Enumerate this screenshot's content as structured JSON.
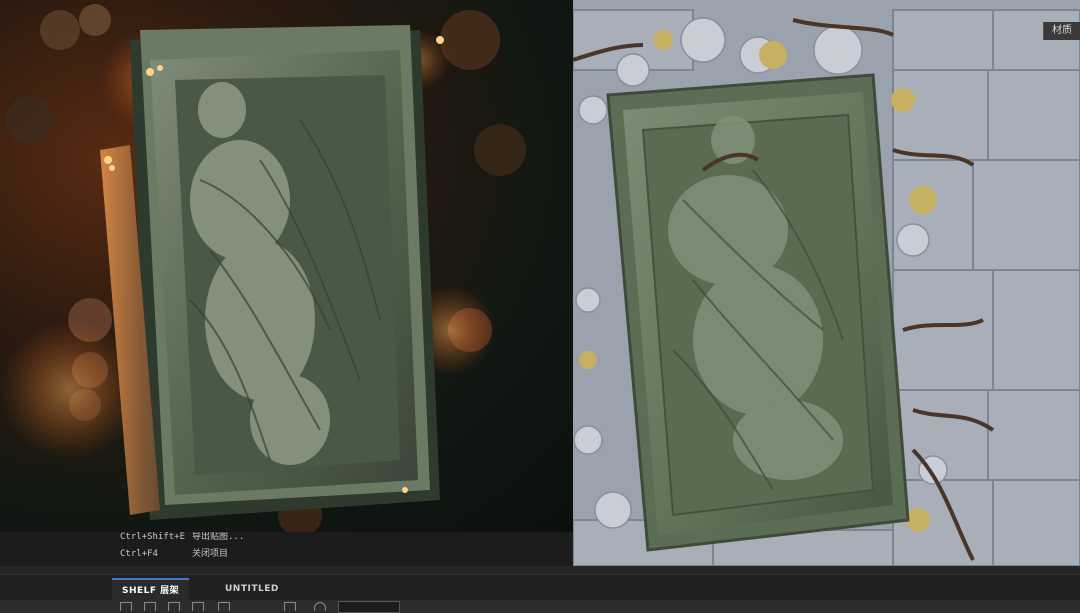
{
  "material_tag": "材质",
  "console": {
    "commands": [
      {
        "shortcut": "Ctrl+Shift+E",
        "action": "导出贴图..."
      },
      {
        "shortcut": "Ctrl+F4",
        "action": "关闭项目"
      }
    ]
  },
  "tabs": [
    {
      "label": "SHELF 层架",
      "active": true
    },
    {
      "label": "UNTITLED",
      "active": false
    }
  ],
  "toolbar": {
    "icons": [
      "folder-icon",
      "layers-icon",
      "brush-icon",
      "scissors-icon",
      "frame-icon",
      "save-icon",
      "circle-icon"
    ]
  },
  "colors": {
    "accent_blue": "#3d7cc9",
    "stone_green": "#5f7257",
    "floor_stone": "#9aa2ad",
    "ember_orange": "#d9621e"
  }
}
